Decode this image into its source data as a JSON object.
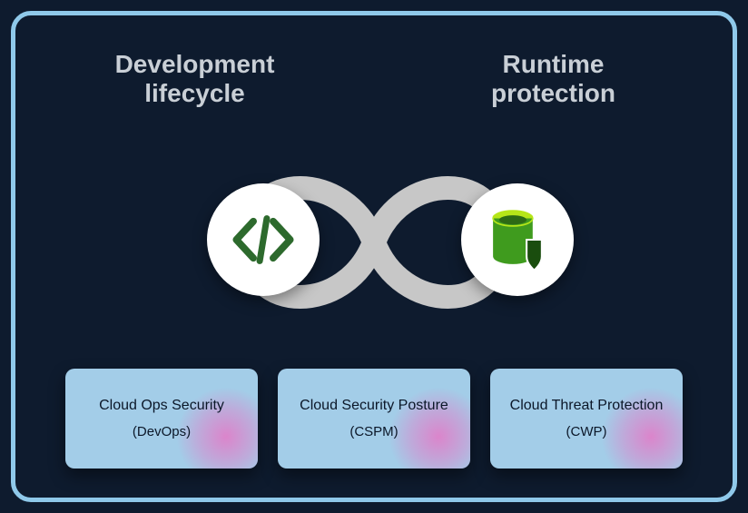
{
  "headings": {
    "left_line1": "Development",
    "left_line2": "lifecycle",
    "right_line1": "Runtime",
    "right_line2": "protection"
  },
  "icons": {
    "left": "code-icon",
    "right": "database-shield-icon"
  },
  "cards": [
    {
      "title": "Cloud Ops Security",
      "sub": "(DevOps)"
    },
    {
      "title": "Cloud Security Posture",
      "sub": "(CSPM)"
    },
    {
      "title": "Cloud Threat Protection",
      "sub": "(CWP)"
    }
  ]
}
